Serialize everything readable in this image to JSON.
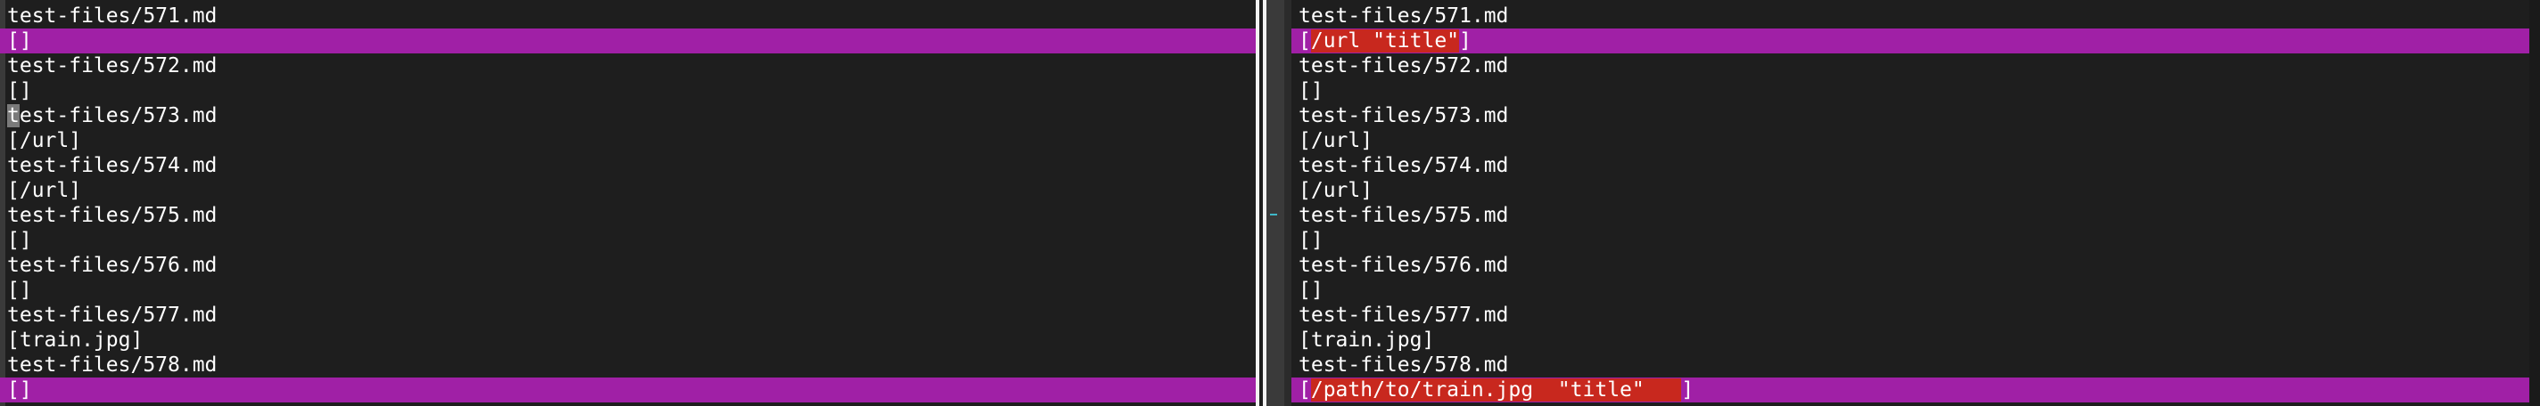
{
  "left_pane": {
    "lines": [
      {
        "text": "test-files/571.md",
        "highlight": false
      },
      {
        "text": "[]",
        "highlight": true
      },
      {
        "text": "test-files/572.md",
        "highlight": false
      },
      {
        "text": "[]",
        "highlight": false
      },
      {
        "text": "test-files/573.md",
        "highlight": false
      },
      {
        "text": "[/url]",
        "highlight": false
      },
      {
        "text": "test-files/574.md",
        "highlight": false
      },
      {
        "text": "[/url]",
        "highlight": false
      },
      {
        "text": "test-files/575.md",
        "highlight": false
      },
      {
        "text": "[]",
        "highlight": false
      },
      {
        "text": "test-files/576.md",
        "highlight": false
      },
      {
        "text": "[]",
        "highlight": false
      },
      {
        "text": "test-files/577.md",
        "highlight": false
      },
      {
        "text": "[train.jpg]",
        "highlight": false
      },
      {
        "text": "test-files/578.md",
        "highlight": false
      },
      {
        "text": "[]",
        "highlight": true
      }
    ]
  },
  "right_pane": {
    "lines": [
      {
        "text": "test-files/571.md",
        "highlight": false
      },
      {
        "pre": "[",
        "del": "/url \"title\"",
        "post": "]",
        "highlight": true
      },
      {
        "text": "test-files/572.md",
        "highlight": false
      },
      {
        "text": "[]",
        "highlight": false
      },
      {
        "text": "test-files/573.md",
        "highlight": false
      },
      {
        "text": "[/url]",
        "highlight": false
      },
      {
        "text": "test-files/574.md",
        "highlight": false
      },
      {
        "text": "[/url]",
        "highlight": false
      },
      {
        "text": "test-files/575.md",
        "highlight": false
      },
      {
        "text": "[]",
        "highlight": false
      },
      {
        "text": "test-files/576.md",
        "highlight": false
      },
      {
        "text": "[]",
        "highlight": false
      },
      {
        "text": "test-files/577.md",
        "highlight": false
      },
      {
        "text": "[train.jpg]",
        "highlight": false
      },
      {
        "text": "test-files/578.md",
        "highlight": false
      },
      {
        "pre": "[",
        "del": "/path/to/train.jpg  \"title\"   ",
        "post": "]",
        "highlight": true
      }
    ]
  },
  "colors": {
    "background": "#1e1e1e",
    "changed_line": "#a020a6",
    "changed_text": "#c8281e",
    "divider": "#f2f2f2"
  }
}
